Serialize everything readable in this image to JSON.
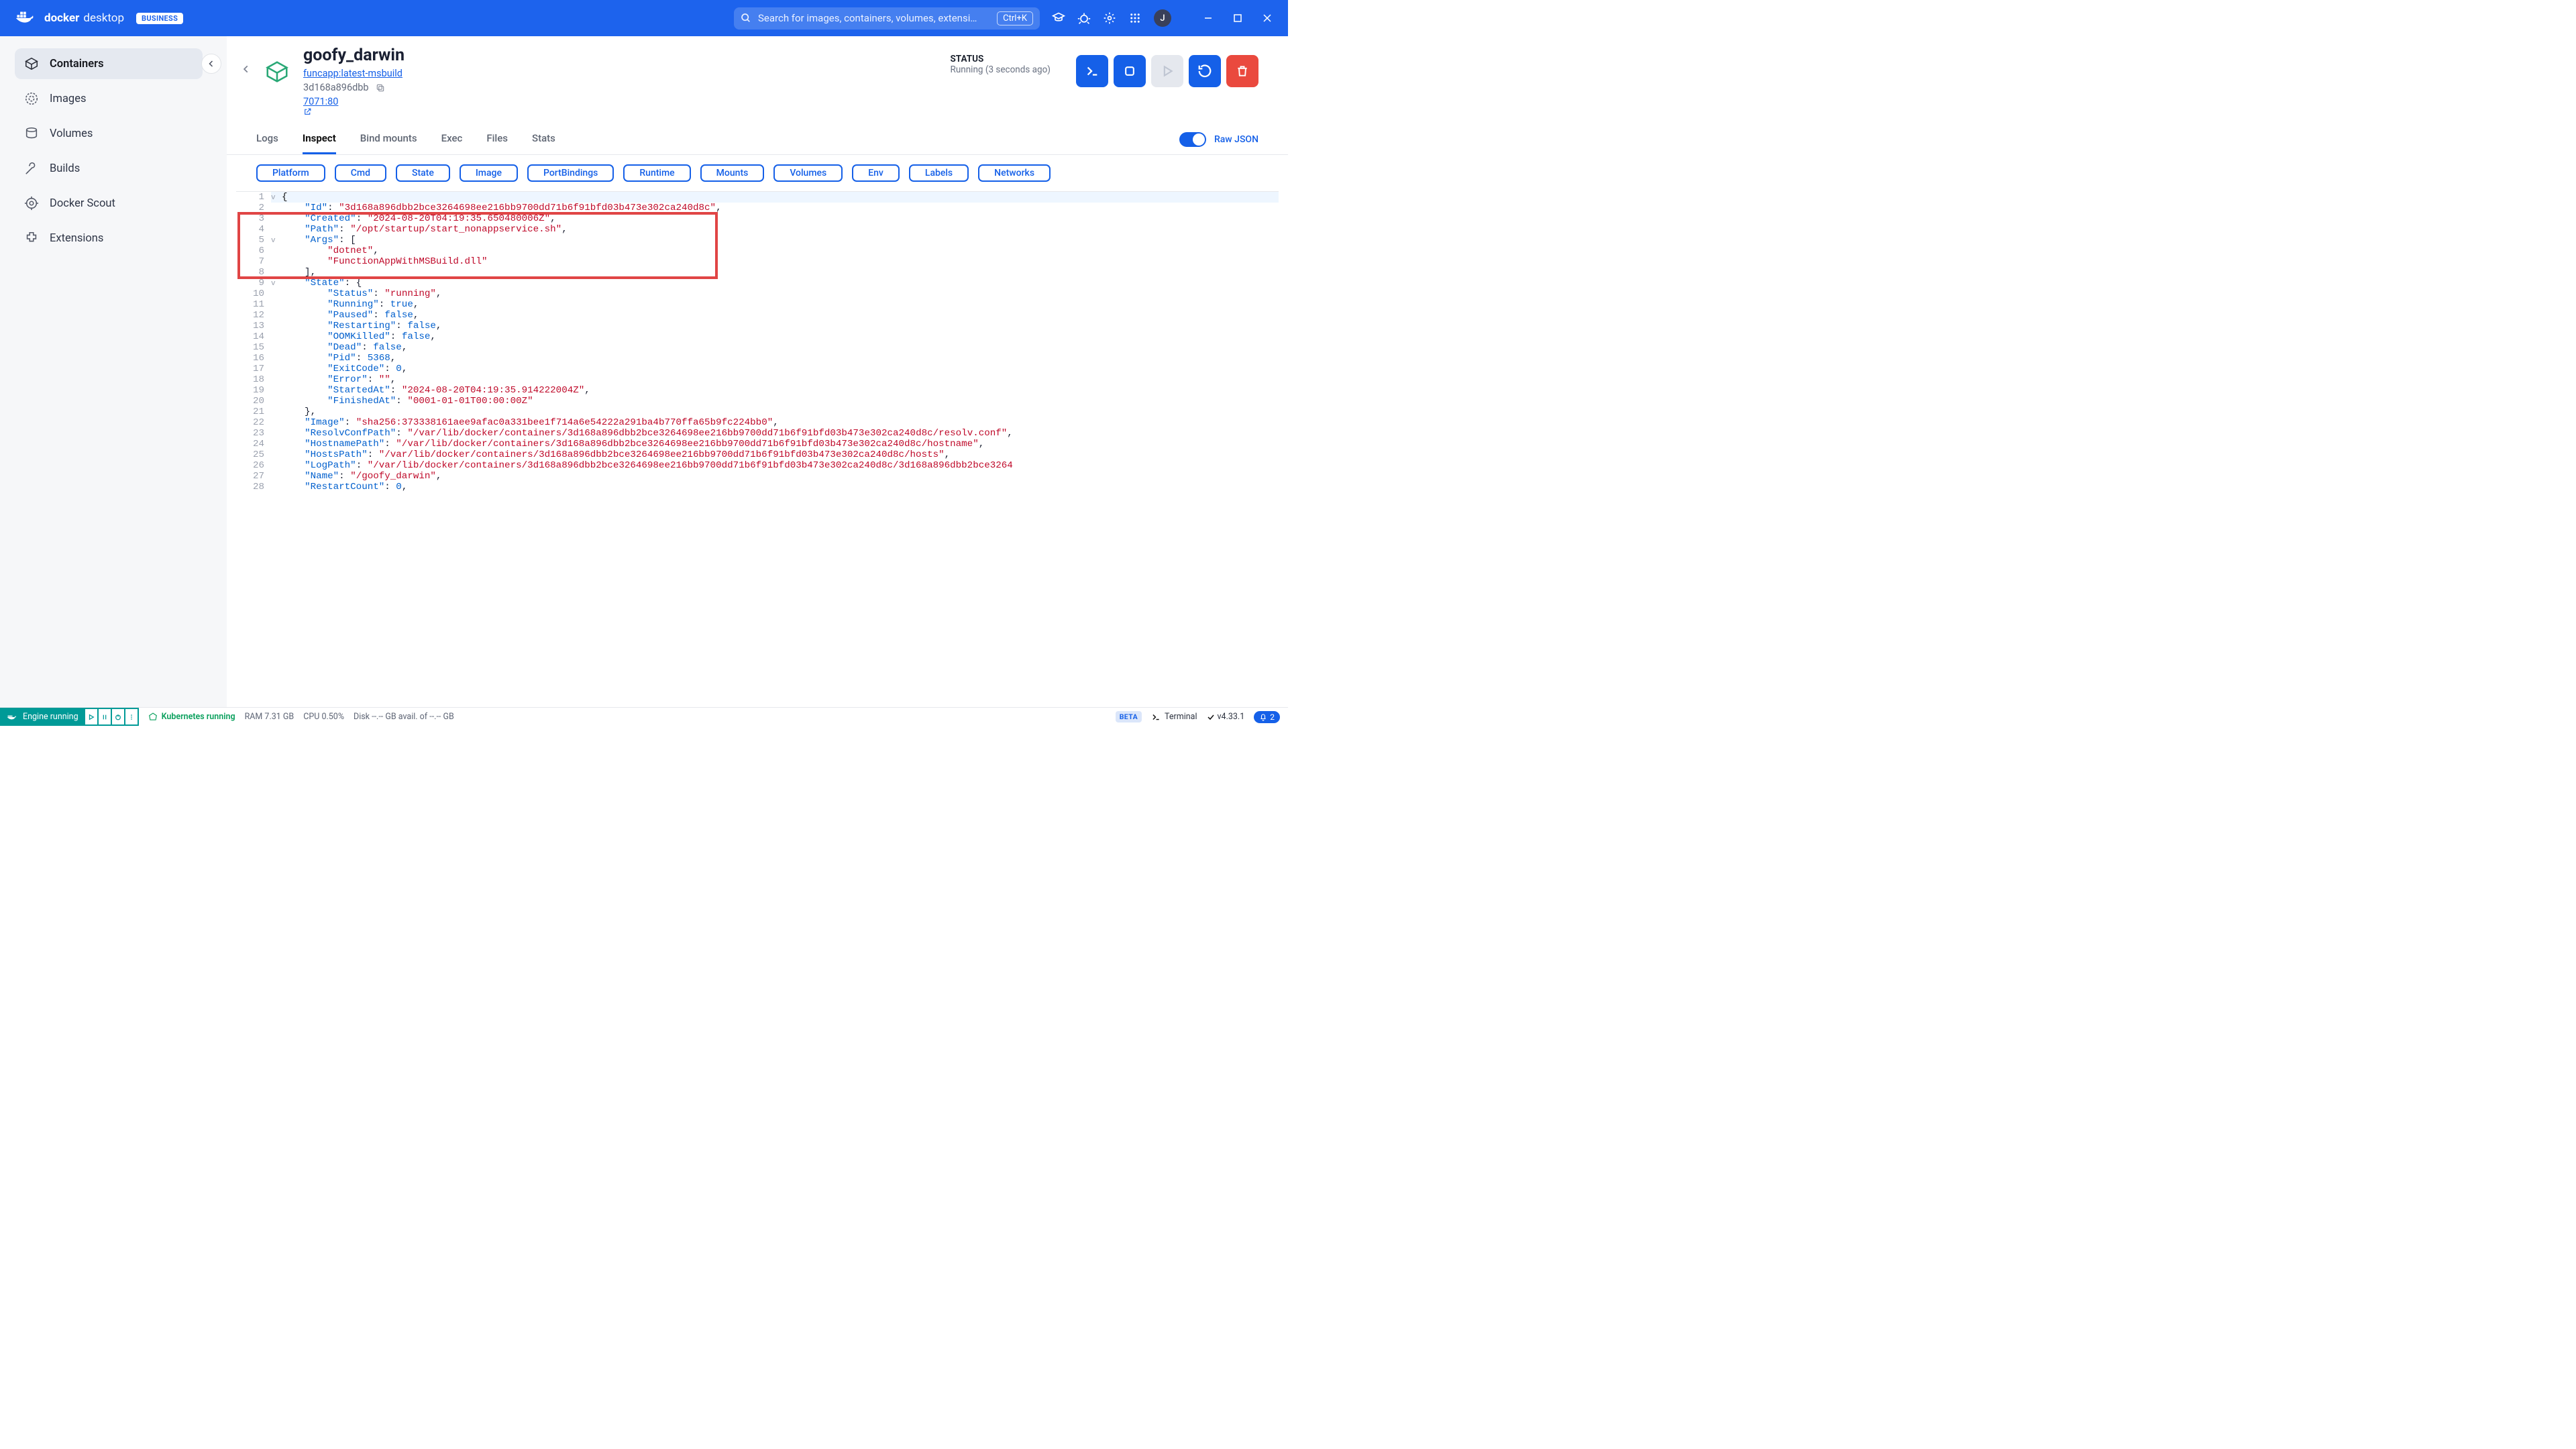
{
  "titlebar": {
    "product_bold": "docker",
    "product_light": "desktop",
    "badge": "BUSINESS",
    "search_placeholder": "Search for images, containers, volumes, extensi…",
    "search_shortcut": "Ctrl+K",
    "avatar_initial": "J"
  },
  "sidebar": {
    "items": [
      {
        "label": "Containers"
      },
      {
        "label": "Images"
      },
      {
        "label": "Volumes"
      },
      {
        "label": "Builds"
      },
      {
        "label": "Docker Scout"
      },
      {
        "label": "Extensions"
      }
    ]
  },
  "header": {
    "name": "goofy_darwin",
    "image_link": "funcapp:latest-msbuild",
    "hash": "3d168a896dbb",
    "port_text": "7071:80",
    "status_label": "STATUS",
    "status_value": "Running (3 seconds ago)"
  },
  "tabs": [
    {
      "label": "Logs"
    },
    {
      "label": "Inspect"
    },
    {
      "label": "Bind mounts"
    },
    {
      "label": "Exec"
    },
    {
      "label": "Files"
    },
    {
      "label": "Stats"
    }
  ],
  "raw_json_label": "Raw JSON",
  "chips": [
    "Platform",
    "Cmd",
    "State",
    "Image",
    "PortBindings",
    "Runtime",
    "Mounts",
    "Volumes",
    "Env",
    "Labels",
    "Networks"
  ],
  "json_lines": [
    {
      "n": 1,
      "fold": "v",
      "hl": true,
      "segs": [
        [
          "{",
          "brack"
        ]
      ]
    },
    {
      "n": 2,
      "segs": [
        [
          "    ",
          ""
        ],
        [
          "\"Id\"",
          "key"
        ],
        [
          ": ",
          ""
        ],
        [
          "\"3d168a896dbb2bce3264698ee216bb9700dd71b6f91bfd03b473e302ca240d8c\"",
          "str"
        ],
        [
          ",",
          ""
        ]
      ]
    },
    {
      "n": 3,
      "segs": [
        [
          "    ",
          ""
        ],
        [
          "\"Created\"",
          "key"
        ],
        [
          ": ",
          ""
        ],
        [
          "\"2024-08-20T04:19:35.650480006Z\"",
          "str"
        ],
        [
          ",",
          ""
        ]
      ]
    },
    {
      "n": 4,
      "segs": [
        [
          "    ",
          ""
        ],
        [
          "\"Path\"",
          "key"
        ],
        [
          ": ",
          ""
        ],
        [
          "\"/opt/startup/start_nonappservice.sh\"",
          "str"
        ],
        [
          ",",
          ""
        ]
      ]
    },
    {
      "n": 5,
      "fold": "v",
      "segs": [
        [
          "    ",
          ""
        ],
        [
          "\"Args\"",
          "key"
        ],
        [
          ": [",
          ""
        ]
      ]
    },
    {
      "n": 6,
      "segs": [
        [
          "        ",
          ""
        ],
        [
          "\"dotnet\"",
          "str"
        ],
        [
          ",",
          ""
        ]
      ]
    },
    {
      "n": 7,
      "segs": [
        [
          "        ",
          ""
        ],
        [
          "\"FunctionAppWithMSBuild.dll\"",
          "str"
        ]
      ]
    },
    {
      "n": 8,
      "segs": [
        [
          "    ],",
          ""
        ]
      ]
    },
    {
      "n": 9,
      "fold": "v",
      "segs": [
        [
          "    ",
          ""
        ],
        [
          "\"State\"",
          "key"
        ],
        [
          ": {",
          ""
        ]
      ]
    },
    {
      "n": 10,
      "segs": [
        [
          "        ",
          ""
        ],
        [
          "\"Status\"",
          "key"
        ],
        [
          ": ",
          ""
        ],
        [
          "\"running\"",
          "str"
        ],
        [
          ",",
          ""
        ]
      ]
    },
    {
      "n": 11,
      "segs": [
        [
          "        ",
          ""
        ],
        [
          "\"Running\"",
          "key"
        ],
        [
          ": ",
          ""
        ],
        [
          "true",
          "bool"
        ],
        [
          ",",
          ""
        ]
      ]
    },
    {
      "n": 12,
      "segs": [
        [
          "        ",
          ""
        ],
        [
          "\"Paused\"",
          "key"
        ],
        [
          ": ",
          ""
        ],
        [
          "false",
          "bool"
        ],
        [
          ",",
          ""
        ]
      ]
    },
    {
      "n": 13,
      "segs": [
        [
          "        ",
          ""
        ],
        [
          "\"Restarting\"",
          "key"
        ],
        [
          ": ",
          ""
        ],
        [
          "false",
          "bool"
        ],
        [
          ",",
          ""
        ]
      ]
    },
    {
      "n": 14,
      "segs": [
        [
          "        ",
          ""
        ],
        [
          "\"OOMKilled\"",
          "key"
        ],
        [
          ": ",
          ""
        ],
        [
          "false",
          "bool"
        ],
        [
          ",",
          ""
        ]
      ]
    },
    {
      "n": 15,
      "segs": [
        [
          "        ",
          ""
        ],
        [
          "\"Dead\"",
          "key"
        ],
        [
          ": ",
          ""
        ],
        [
          "false",
          "bool"
        ],
        [
          ",",
          ""
        ]
      ]
    },
    {
      "n": 16,
      "segs": [
        [
          "        ",
          ""
        ],
        [
          "\"Pid\"",
          "key"
        ],
        [
          ": ",
          ""
        ],
        [
          "5368",
          "num"
        ],
        [
          ",",
          ""
        ]
      ]
    },
    {
      "n": 17,
      "segs": [
        [
          "        ",
          ""
        ],
        [
          "\"ExitCode\"",
          "key"
        ],
        [
          ": ",
          ""
        ],
        [
          "0",
          "num"
        ],
        [
          ",",
          ""
        ]
      ]
    },
    {
      "n": 18,
      "segs": [
        [
          "        ",
          ""
        ],
        [
          "\"Error\"",
          "key"
        ],
        [
          ": ",
          ""
        ],
        [
          "\"\"",
          "str"
        ],
        [
          ",",
          ""
        ]
      ]
    },
    {
      "n": 19,
      "segs": [
        [
          "        ",
          ""
        ],
        [
          "\"StartedAt\"",
          "key"
        ],
        [
          ": ",
          ""
        ],
        [
          "\"2024-08-20T04:19:35.914222004Z\"",
          "str"
        ],
        [
          ",",
          ""
        ]
      ]
    },
    {
      "n": 20,
      "segs": [
        [
          "        ",
          ""
        ],
        [
          "\"FinishedAt\"",
          "key"
        ],
        [
          ": ",
          ""
        ],
        [
          "\"0001-01-01T00:00:00Z\"",
          "str"
        ]
      ]
    },
    {
      "n": 21,
      "segs": [
        [
          "    },",
          ""
        ]
      ]
    },
    {
      "n": 22,
      "segs": [
        [
          "    ",
          ""
        ],
        [
          "\"Image\"",
          "key"
        ],
        [
          ": ",
          ""
        ],
        [
          "\"sha256:373338161aee9afac0a331bee1f714a6e54222a291ba4b770ffa65b9fc224bb0\"",
          "str"
        ],
        [
          ",",
          ""
        ]
      ]
    },
    {
      "n": 23,
      "segs": [
        [
          "    ",
          ""
        ],
        [
          "\"ResolvConfPath\"",
          "key"
        ],
        [
          ": ",
          ""
        ],
        [
          "\"/var/lib/docker/containers/3d168a896dbb2bce3264698ee216bb9700dd71b6f91bfd03b473e302ca240d8c/resolv.conf\"",
          "str"
        ],
        [
          ",",
          ""
        ]
      ]
    },
    {
      "n": 24,
      "segs": [
        [
          "    ",
          ""
        ],
        [
          "\"HostnamePath\"",
          "key"
        ],
        [
          ": ",
          ""
        ],
        [
          "\"/var/lib/docker/containers/3d168a896dbb2bce3264698ee216bb9700dd71b6f91bfd03b473e302ca240d8c/hostname\"",
          "str"
        ],
        [
          ",",
          ""
        ]
      ]
    },
    {
      "n": 25,
      "segs": [
        [
          "    ",
          ""
        ],
        [
          "\"HostsPath\"",
          "key"
        ],
        [
          ": ",
          ""
        ],
        [
          "\"/var/lib/docker/containers/3d168a896dbb2bce3264698ee216bb9700dd71b6f91bfd03b473e302ca240d8c/hosts\"",
          "str"
        ],
        [
          ",",
          ""
        ]
      ]
    },
    {
      "n": 26,
      "segs": [
        [
          "    ",
          ""
        ],
        [
          "\"LogPath\"",
          "key"
        ],
        [
          ": ",
          ""
        ],
        [
          "\"/var/lib/docker/containers/3d168a896dbb2bce3264698ee216bb9700dd71b6f91bfd03b473e302ca240d8c/3d168a896dbb2bce3264",
          "str"
        ]
      ]
    },
    {
      "n": 27,
      "segs": [
        [
          "    ",
          ""
        ],
        [
          "\"Name\"",
          "key"
        ],
        [
          ": ",
          ""
        ],
        [
          "\"/goofy_darwin\"",
          "str"
        ],
        [
          ",",
          ""
        ]
      ]
    },
    {
      "n": 28,
      "segs": [
        [
          "    ",
          ""
        ],
        [
          "\"RestartCount\"",
          "key"
        ],
        [
          ": ",
          ""
        ],
        [
          "0",
          "num"
        ],
        [
          ",",
          ""
        ]
      ]
    }
  ],
  "statusbar": {
    "engine": "Engine running",
    "k8s": "Kubernetes running",
    "ram": "RAM 7.31 GB",
    "cpu": "CPU 0.50%",
    "disk": "Disk --.-- GB avail. of --.-- GB",
    "beta": "BETA",
    "terminal": "Terminal",
    "version": "v4.33.1",
    "notif_count": "2"
  }
}
